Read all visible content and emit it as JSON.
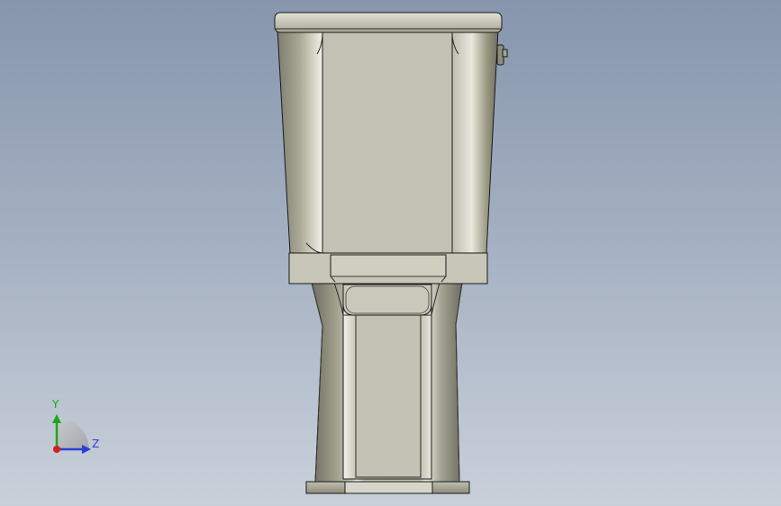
{
  "viewport": {
    "background_top": "#8796ad",
    "background_bottom": "#c9d0da"
  },
  "model": {
    "part": "toilet",
    "view": "front",
    "shade_color": "#c4c3b5",
    "edge_color": "#1a1a1a"
  },
  "triad": {
    "y_label": "Y",
    "z_label": "Z",
    "y_color": "#1ea51e",
    "z_color": "#2a3fd6",
    "x_color": "#d62020"
  }
}
